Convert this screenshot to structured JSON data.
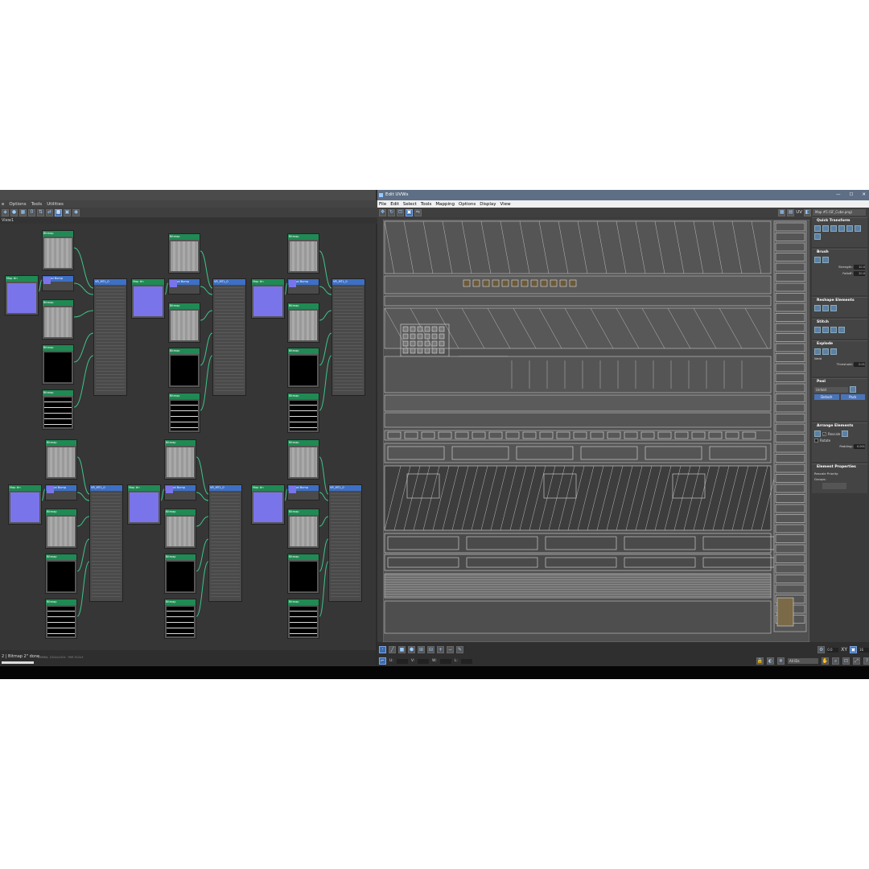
{
  "slate": {
    "menu": [
      "e",
      "Options",
      "Tools",
      "Utilities"
    ],
    "view_tab": "View1",
    "status_text": "2  | Bitmap 2\" done",
    "status_sub": "26MBit, 1024x1024 · 999 512x3",
    "nodes": {
      "map": "Map #n",
      "bitmap": "Bitmap",
      "normal_bump": "Normal Bump",
      "material": "VR_MTL_0",
      "material_sub": "VRayMtl"
    },
    "material_slots": [
      "Diffuse",
      "Reflect",
      "Refl gloss",
      "Refract",
      "Bump",
      "Opacity",
      "Self-illum"
    ]
  },
  "uvw": {
    "title": "Edit UVWs",
    "window_controls": [
      "—",
      "☐",
      "✕"
    ],
    "menu": [
      "File",
      "Edit",
      "Select",
      "Tools",
      "Mapping",
      "Options",
      "Display",
      "View"
    ],
    "toolbar_label": "UV",
    "map_selector": "Map #5 (SF_Cube.png)",
    "panels": {
      "quick_transform": "Quick Transform",
      "brush": "Brush",
      "brush_strength_label": "Strength:",
      "brush_strength": "10.0",
      "brush_falloff_label": "Falloff:",
      "brush_falloff": "20.0",
      "reshape": "Reshape Elements",
      "stitch": "Stitch",
      "explode": "Explode",
      "explode_weld": "Weld",
      "explode_threshold_label": "Threshold:",
      "explode_threshold": "0.01",
      "peel": "Peel",
      "peel_mode": "Unfold",
      "peel_detach": "Detach",
      "peel_pack": "Pack",
      "arrange": "Arrange Elements",
      "arrange_rescale": "Rescale",
      "arrange_rotate": "Rotate",
      "arrange_padding_label": "Padding:",
      "arrange_padding": "0.001",
      "element_props": "Element Properties",
      "rescale_priority": "Rescale Priority:",
      "groups": "Groups:"
    },
    "bottom": {
      "u_label": "U:",
      "v_label": "V:",
      "w_label": "W:",
      "l_label": "L:",
      "xy_label": "XY",
      "dropdown": "All IDs",
      "value_right": "16",
      "value_snap": "0.0"
    }
  }
}
